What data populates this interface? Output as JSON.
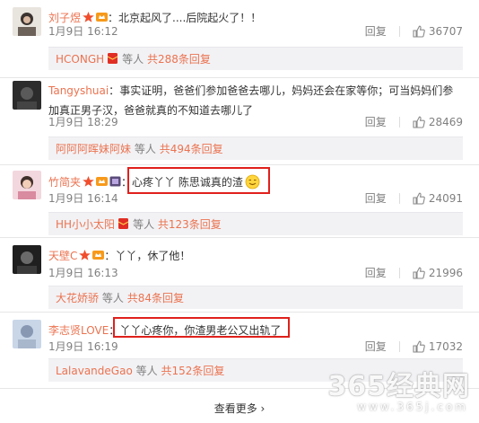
{
  "comments": [
    {
      "user": "刘子煜",
      "text": "北京起风了....后院起火了！！",
      "date": "1月9日 16:12",
      "reply_label": "回复",
      "likes": "36707",
      "sub_user": "HCONGH",
      "sub_mid": "等人",
      "sub_total": "共288条回复"
    },
    {
      "user": "Tangyshuai",
      "text": "事实证明，爸爸们参加爸爸去哪儿，妈妈还会在家等你；可当妈妈们参加真正男子汉，爸爸就真的不知道去哪儿了",
      "date": "1月9日 18:29",
      "reply_label": "回复",
      "likes": "28469",
      "sub_user": "阿阿阿晖妹阿妹",
      "sub_mid": "等人",
      "sub_total": "共494条回复"
    },
    {
      "user": "竹简夹",
      "text": "心疼丫丫 陈思诚真的渣",
      "date": "1月9日 16:14",
      "reply_label": "回复",
      "likes": "24091",
      "sub_user": "HH小小太阳",
      "sub_mid": "等人",
      "sub_total": "共123条回复"
    },
    {
      "user": "天壁C",
      "text": "丫丫，休了他！",
      "date": "1月9日 16:13",
      "reply_label": "回复",
      "likes": "21996",
      "sub_user": "大花娇骄",
      "sub_mid": "等人",
      "sub_total": "共84条回复"
    },
    {
      "user": "李志贤LOVE",
      "text": "丫丫心疼你，你渣男老公又出轨了",
      "date": "1月9日 16:19",
      "reply_label": "回复",
      "likes": "17032",
      "sub_user": "LalavandeGao",
      "sub_mid": "等人",
      "sub_total": "共152条回复"
    }
  ],
  "more_label": "查看更多 ›",
  "watermark": {
    "main": "365经典网",
    "sub": "www.365j.com"
  },
  "colors": {
    "username": "#eb7350",
    "highlight_box": "#e0201c",
    "sub_bg": "#f2f2f5"
  }
}
